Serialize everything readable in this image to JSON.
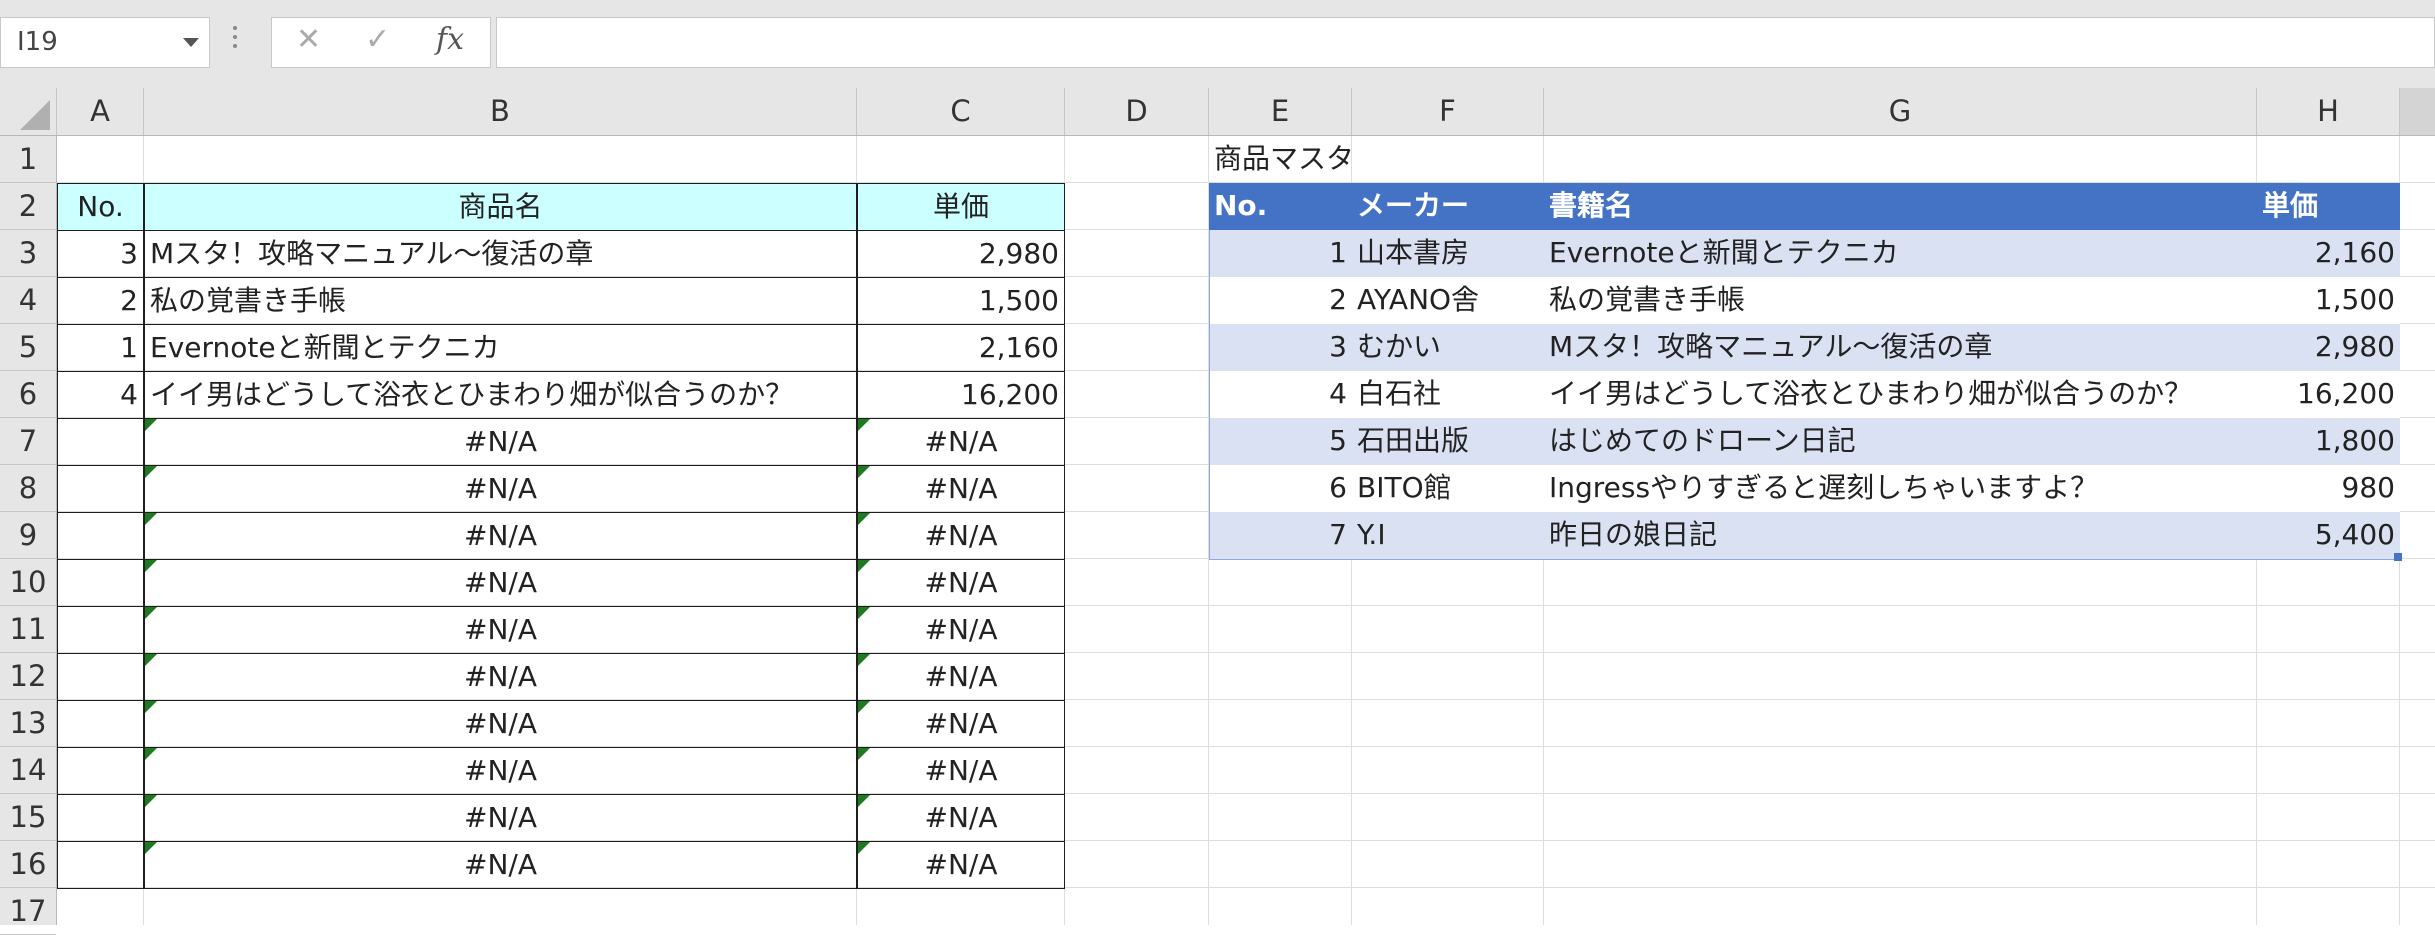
{
  "name_box": "I19",
  "formula_bar": {
    "value": "",
    "icons": [
      "cancel-icon",
      "enter-icon",
      "fx-icon"
    ],
    "fx_label": "fx"
  },
  "columns": [
    "A",
    "B",
    "C",
    "D",
    "E",
    "F",
    "G",
    "H"
  ],
  "rows": [
    "1",
    "2",
    "3",
    "4",
    "5",
    "6",
    "7",
    "8",
    "9",
    "10",
    "11",
    "12",
    "13",
    "14",
    "15",
    "16",
    "17"
  ],
  "left_table": {
    "headers": [
      "No.",
      "商品名",
      "単価"
    ],
    "rows": [
      [
        "3",
        "Mスタ！攻略マニュアル～復活の章",
        "2,980"
      ],
      [
        "2",
        "私の覚書き手帳",
        "1,500"
      ],
      [
        "1",
        "Evernoteと新聞とテクニカ",
        "2,160"
      ],
      [
        "4",
        "イイ男はどうして浴衣とひまわり畑が似合うのか？",
        "16,200"
      ],
      [
        "",
        "#N/A",
        "#N/A"
      ],
      [
        "",
        "#N/A",
        "#N/A"
      ],
      [
        "",
        "#N/A",
        "#N/A"
      ],
      [
        "",
        "#N/A",
        "#N/A"
      ],
      [
        "",
        "#N/A",
        "#N/A"
      ],
      [
        "",
        "#N/A",
        "#N/A"
      ],
      [
        "",
        "#N/A",
        "#N/A"
      ],
      [
        "",
        "#N/A",
        "#N/A"
      ],
      [
        "",
        "#N/A",
        "#N/A"
      ],
      [
        "",
        "#N/A",
        "#N/A"
      ]
    ]
  },
  "master_table": {
    "title": "商品マスタ",
    "headers": [
      "No.",
      "メーカー",
      "書籍名",
      "単価"
    ],
    "rows": [
      [
        "1",
        "山本書房",
        "Evernoteと新聞とテクニカ",
        "2,160"
      ],
      [
        "2",
        "AYANO舎",
        "私の覚書き手帳",
        "1,500"
      ],
      [
        "3",
        "むかい",
        "Mスタ！攻略マニュアル～復活の章",
        "2,980"
      ],
      [
        "4",
        "白石社",
        "イイ男はどうして浴衣とひまわり畑が似合うのか？",
        "16,200"
      ],
      [
        "5",
        "石田出版",
        "はじめてのドローン日記",
        "1,800"
      ],
      [
        "6",
        "BITO館",
        "Ingressやりすぎると遅刻しちゃいますよ？",
        "980"
      ],
      [
        "7",
        "Y.I",
        "昨日の娘日記",
        "5,400"
      ]
    ]
  },
  "colors": {
    "header_cyan": "#ccffff",
    "table_header_blue": "#4472c4",
    "table_band": "#d9e1f2",
    "error_triangle": "#1f7a1f"
  }
}
